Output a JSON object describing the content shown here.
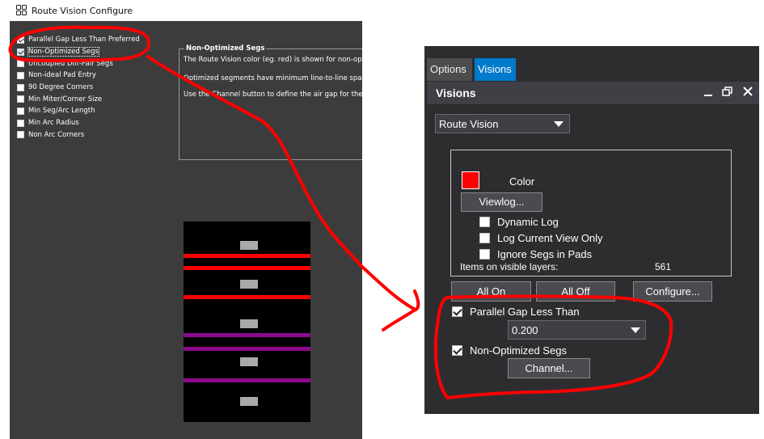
{
  "configure_window": {
    "title": "Route Vision Configure",
    "checkboxes": [
      {
        "label": "Parallel Gap Less Than Preferred",
        "checked": true
      },
      {
        "label": "Non-Optimized Segs",
        "checked": true
      },
      {
        "label": "Uncoupled Diff-Pair Segs",
        "checked": false
      },
      {
        "label": "Non-ideal Pad Entry",
        "checked": false
      },
      {
        "label": "90 Degree Corners",
        "checked": false
      },
      {
        "label": "Min Miter/Corner Size",
        "checked": false
      },
      {
        "label": "Min Seg/Arc Length",
        "checked": false
      },
      {
        "label": "Min Arc Radius",
        "checked": false
      },
      {
        "label": "Non Arc Corners",
        "checked": false
      }
    ],
    "group": {
      "title": "Non-Optimized Segs",
      "lines": [
        "The Route Vision color (eg. red) is shown for non-optimized segments.",
        "Optimized segments have minimum line-to-line spacing.",
        "Use the Channel button to define the air gap for the channel."
      ]
    },
    "preview_colors": {
      "red_seg": "#ff0000",
      "purple_seg": "#8b0a8b",
      "pad": "#a9a9a9"
    }
  },
  "visions_panel": {
    "tabs": [
      {
        "label": "Options",
        "active": false
      },
      {
        "label": "Visions",
        "active": true
      }
    ],
    "header": {
      "title": "Visions",
      "icons": [
        "minimize-icon",
        "restore-icon",
        "close-icon"
      ]
    },
    "vision_type": "Route Vision",
    "color_label": "Color",
    "color_value": "#ff0000",
    "viewlog_label": "Viewlog...",
    "options": [
      {
        "label": "Dynamic Log",
        "checked": false
      },
      {
        "label": "Log Current View Only",
        "checked": false
      },
      {
        "label": "Ignore Segs in Pads",
        "checked": false
      }
    ],
    "items_label": "Items on visible layers:",
    "items_count": "561",
    "buttons": {
      "all_on": "All On",
      "all_off": "All Off",
      "configure": "Configure..."
    },
    "parallel_gap": {
      "label": "Parallel Gap Less Than",
      "checked": true,
      "value": "0.200"
    },
    "non_optimized": {
      "label": "Non-Optimized Segs",
      "checked": true
    },
    "channel_label": "Channel..."
  },
  "annotation_color": "#ff0000"
}
